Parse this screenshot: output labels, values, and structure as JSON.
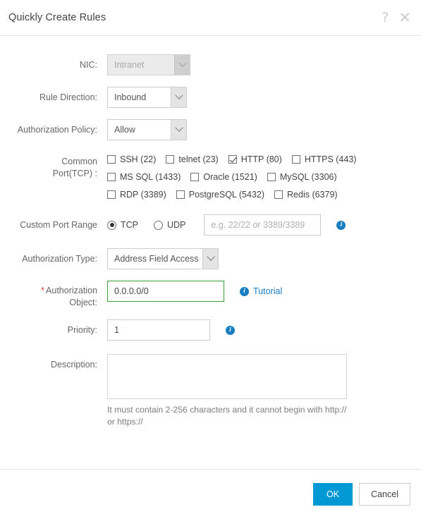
{
  "dialog": {
    "title": "Quickly Create Rules",
    "help_icon": "question-mark-icon",
    "close_icon": "close-icon",
    "help_glyph": "?",
    "close_glyph": "✕"
  },
  "form": {
    "nic": {
      "label": "NIC:",
      "value": "Intranet",
      "disabled": true
    },
    "rule_direction": {
      "label": "Rule Direction:",
      "value": "Inbound"
    },
    "authorization_policy": {
      "label": "Authorization Policy:",
      "value": "Allow"
    },
    "common_port": {
      "label_line1": "Common",
      "label_line2": "Port(TCP) :",
      "rows": [
        [
          {
            "label": "SSH (22)",
            "checked": false
          },
          {
            "label": "telnet (23)",
            "checked": false
          },
          {
            "label": "HTTP (80)",
            "checked": true
          },
          {
            "label": "HTTPS (443)",
            "checked": false
          }
        ],
        [
          {
            "label": "MS SQL (1433)",
            "checked": false
          },
          {
            "label": "Oracle (1521)",
            "checked": false
          },
          {
            "label": "MySQL (3306)",
            "checked": false
          }
        ],
        [
          {
            "label": "RDP (3389)",
            "checked": false
          },
          {
            "label": "PostgreSQL (5432)",
            "checked": false
          },
          {
            "label": "Redis (6379)",
            "checked": false
          }
        ]
      ]
    },
    "custom_port_range": {
      "label": "Custom Port Range",
      "protocols": [
        {
          "label": "TCP",
          "selected": true
        },
        {
          "label": "UDP",
          "selected": false
        }
      ],
      "placeholder": "e.g. 22/22 or 3389/3389",
      "value": "",
      "info_icon": "info-icon"
    },
    "authorization_type": {
      "label": "Authorization Type:",
      "value": "Address Field Access"
    },
    "authorization_object": {
      "label_line1": "Authorization",
      "label_line2": "Object:",
      "required_marker": "*",
      "value": "0.0.0.0/0",
      "info_icon": "info-icon",
      "tutorial_label": "Tutorial"
    },
    "priority": {
      "label": "Priority:",
      "value": "1",
      "info_icon": "info-icon"
    },
    "description": {
      "label": "Description:",
      "value": "",
      "hint": "It must contain 2-256 characters and it cannot begin with http:// or https://"
    }
  },
  "footer": {
    "ok_label": "OK",
    "cancel_label": "Cancel"
  },
  "colors": {
    "accent": "#0099d5",
    "link": "#1b7fc4",
    "valid_border": "#3a9e3a",
    "required": "#e4393c"
  }
}
